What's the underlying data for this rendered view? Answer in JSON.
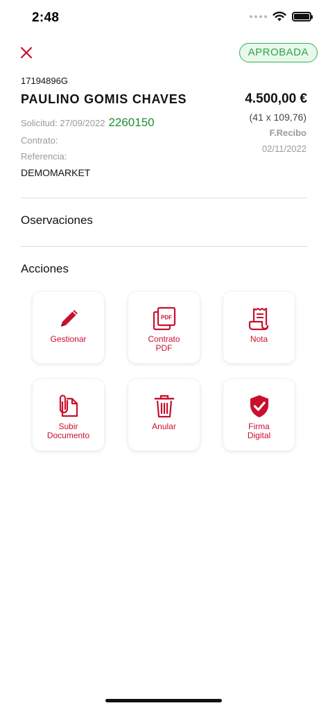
{
  "status_bar": {
    "time": "2:48"
  },
  "header": {
    "badge": "APROBADA"
  },
  "client": {
    "id": "17194896G",
    "name": "PAULINO GOMIS CHAVES",
    "amount": "4.500,00 €",
    "installments": "(41 x 109,76)",
    "recibo_label": "F.Recibo",
    "recibo_date": "02/11/2022",
    "solicitud_label": "Solicitud: 27/09/2022",
    "solicitud_number": "2260150",
    "contrato_label": "Contrato:",
    "referencia_label": "Referencia:",
    "store": "DEMOMARKET"
  },
  "sections": {
    "observaciones": "Oservaciones",
    "acciones": "Acciones"
  },
  "actions": [
    {
      "label": "Gestionar",
      "icon": "pencil-icon"
    },
    {
      "label": "Contrato\nPDF",
      "icon": "pdf-icon"
    },
    {
      "label": "Nota",
      "icon": "receipt-icon"
    },
    {
      "label": "Subir\nDocumento",
      "icon": "attachment-icon"
    },
    {
      "label": "Anular",
      "icon": "trash-icon"
    },
    {
      "label": "Firma\nDigital",
      "icon": "shield-check-icon"
    }
  ],
  "colors": {
    "accent": "#c8102e",
    "approved": "#2fa444",
    "solicitud_number": "#1e8f2e"
  }
}
